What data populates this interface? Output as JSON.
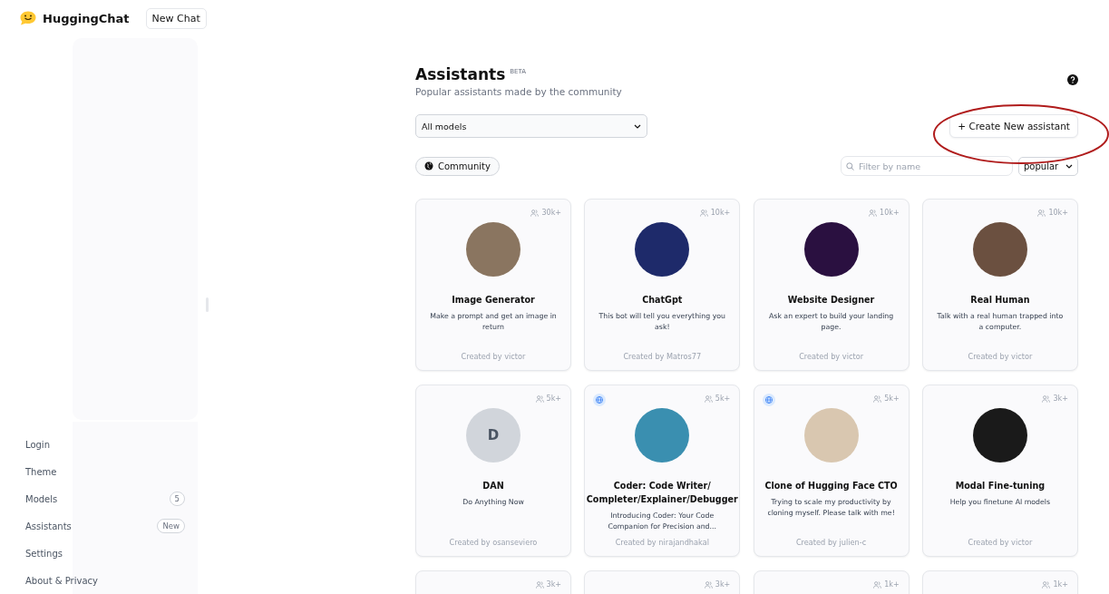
{
  "header": {
    "brand": "HuggingChat",
    "new_chat": "New Chat"
  },
  "sidebar": {
    "items": [
      {
        "label": "Login"
      },
      {
        "label": "Theme"
      },
      {
        "label": "Models",
        "badge": "5"
      },
      {
        "label": "Assistants",
        "badge": "New"
      },
      {
        "label": "Settings"
      },
      {
        "label": "About & Privacy"
      }
    ]
  },
  "page": {
    "title": "Assistants",
    "title_tag": "BETA",
    "subtitle": "Popular assistants made by the community",
    "model_select": "All models",
    "create_button": {
      "label": "+ Create New assistant",
      "circled": true
    },
    "community_button": "Community",
    "filter": {
      "placeholder": "Filter by name"
    },
    "sort_select": "popular"
  },
  "cards": [
    {
      "count": "30k+",
      "kind": "photo",
      "name": "Image Generator",
      "description": "Make a prompt and get an image in return",
      "author": "Created by victor",
      "globe": false
    },
    {
      "count": "10k+",
      "kind": "photo",
      "name": "ChatGpt",
      "description": "This bot will tell you everything you ask!",
      "author": "Created by Matros77",
      "globe": false
    },
    {
      "count": "10k+",
      "kind": "photo",
      "name": "Website Designer",
      "description": "Ask an expert to build your landing page.",
      "author": "Created by victor",
      "globe": false
    },
    {
      "count": "10k+",
      "kind": "photo",
      "name": "Real Human",
      "description": "Talk with a real human trapped into a computer.",
      "author": "Created by victor",
      "globe": false
    },
    {
      "count": "5k+",
      "kind": "letter",
      "letter": "D",
      "name": "DAN",
      "description": "Do Anything Now",
      "author": "Created by osanseviero",
      "globe": false
    },
    {
      "count": "5k+",
      "kind": "photo",
      "name": "Coder: Code Writer/ Completer/Explainer/Debugger",
      "description": "Introducing Coder: Your Code Companion for Precision and...",
      "author": "Created by nirajandhakal",
      "globe": true
    },
    {
      "count": "5k+",
      "kind": "photo",
      "name": "Clone of Hugging Face CTO",
      "description": "Trying to scale my productivity by cloning myself. Please talk with me!",
      "author": "Created by julien-c",
      "globe": true
    },
    {
      "count": "3k+",
      "kind": "photo",
      "name": "Modal Fine-tuning",
      "description": "Help you finetune AI models",
      "author": "Created by victor",
      "globe": false
    },
    {
      "count": "3k+",
      "kind": "cut",
      "globe": false
    },
    {
      "count": "3k+",
      "kind": "cut",
      "globe": false
    },
    {
      "count": "1k+",
      "kind": "cut",
      "globe": false
    },
    {
      "count": "1k+",
      "kind": "cut",
      "globe": false
    }
  ]
}
